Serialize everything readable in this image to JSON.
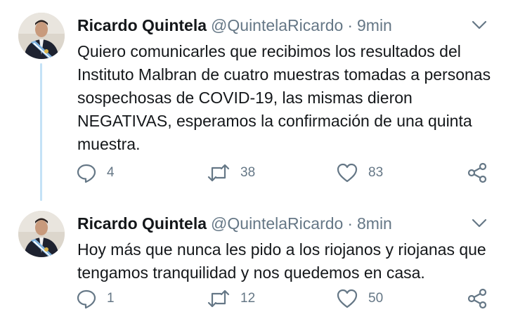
{
  "tweets": [
    {
      "display_name": "Ricardo Quintela",
      "handle": "@QuintelaRicardo",
      "separator": "·",
      "timestamp": "9min",
      "text": "Quiero comunicarles que recibimos los resultados del Instituto Malbran de cuatro muestras tomadas a personas sospechosas de COVID-19, las mismas dieron NEGATIVAS, esperamos la confirmación de una quinta muestra.",
      "replies": "4",
      "retweets": "38",
      "likes": "83"
    },
    {
      "display_name": "Ricardo Quintela",
      "handle": "@QuintelaRicardo",
      "separator": "·",
      "timestamp": "8min",
      "text": "Hoy más que nunca les pido a los riojanos y riojanas que tengamos tranquilidad y nos quedemos en casa.",
      "replies": "1",
      "retweets": "12",
      "likes": "50"
    }
  ],
  "icons": {
    "reply": "reply-icon",
    "retweet": "retweet-icon",
    "like": "heart-icon",
    "share": "share-icon",
    "menu": "chevron-down-icon"
  },
  "colors": {
    "text": "#14171a",
    "secondary": "#657786",
    "thread_line": "#c4e2f6",
    "background": "#ffffff"
  }
}
